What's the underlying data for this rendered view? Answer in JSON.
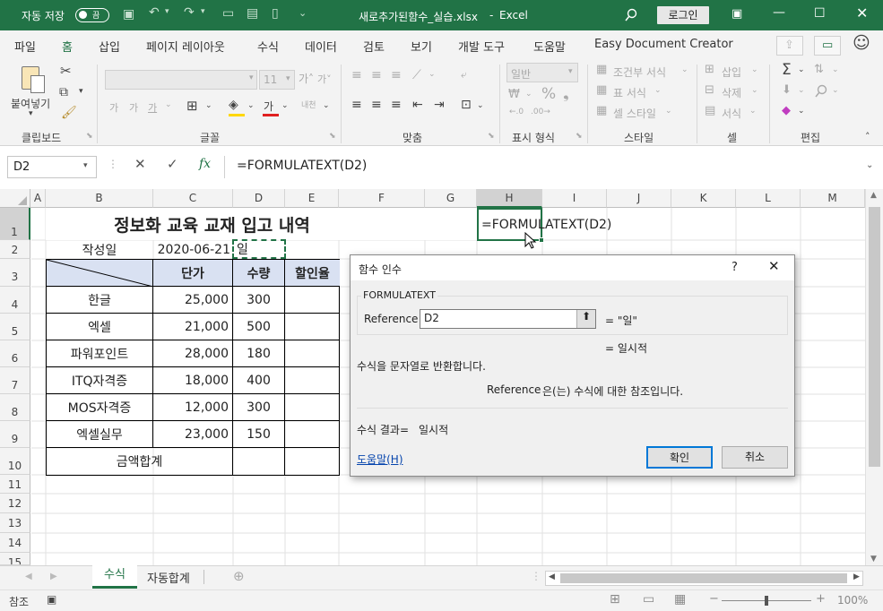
{
  "titlebar": {
    "autosave_label": "자동 저장",
    "autosave_state": "끔",
    "filename": "새로추가된함수_실습.xlsx",
    "app": "Excel",
    "login": "로그인"
  },
  "tabs": [
    "파일",
    "홈",
    "삽입",
    "페이지 레이아웃",
    "수식",
    "데이터",
    "검토",
    "보기",
    "개발 도구",
    "도움말",
    "Easy Document Creator"
  ],
  "ribbon": {
    "paste": "붙여넣기",
    "groups": [
      "클립보드",
      "글꼴",
      "맞춤",
      "표시 형식",
      "스타일",
      "셀",
      "편집"
    ],
    "number_format": "일반",
    "font_size": "11",
    "styles": [
      "조건부 서식",
      "표 서식",
      "셀 스타일"
    ],
    "cells": [
      "삽입",
      "삭제",
      "서식"
    ]
  },
  "formula_bar": {
    "name_box": "D2",
    "formula": "=FORMULATEXT(D2)"
  },
  "columns": [
    "A",
    "B",
    "C",
    "D",
    "E",
    "F",
    "G",
    "H",
    "I",
    "J",
    "K",
    "L",
    "M"
  ],
  "rows": [
    "1",
    "2",
    "3",
    "4",
    "5",
    "6",
    "7",
    "8",
    "9",
    "10",
    "11",
    "12",
    "13",
    "14",
    "15"
  ],
  "sheet": {
    "title": "정보화 교육 교재 입고 내역",
    "author_label": "작성일",
    "date": "2020-06-21",
    "d2": "일",
    "h1": "=FORMULATEXT(D2)",
    "headers": [
      "단가",
      "수량",
      "할인율"
    ],
    "items": [
      {
        "name": "한글",
        "price": "25,000",
        "qty": "300"
      },
      {
        "name": "엑셀",
        "price": "21,000",
        "qty": "500"
      },
      {
        "name": "파워포인트",
        "price": "28,000",
        "qty": "180"
      },
      {
        "name": "ITQ자격증",
        "price": "18,000",
        "qty": "400"
      },
      {
        "name": "MOS자격증",
        "price": "12,000",
        "qty": "300"
      },
      {
        "name": "엑셀실무",
        "price": "23,000",
        "qty": "150"
      }
    ],
    "total_label": "금액합계"
  },
  "dialog": {
    "title": "함수 인수",
    "help_q": "?",
    "func": "FORMULATEXT",
    "arg_label": "Reference",
    "arg_value": "D2",
    "arg_result": "= \"일\"",
    "overall_result": "= 일시적",
    "description": "수식을 문자열로 반환합니다.",
    "arg_desc_name": "Reference",
    "arg_desc": "은(는) 수식에 대한 참조입니다.",
    "result_label": "수식 결과=",
    "result_value": "일시적",
    "help_link": "도움말(H)",
    "ok": "확인",
    "cancel": "취소"
  },
  "sheets": [
    "수식",
    "자동합계"
  ],
  "status": {
    "mode": "참조",
    "zoom": "100%"
  },
  "colors": {
    "excel_green": "#217346",
    "header_fill": "#d9e1f2"
  }
}
